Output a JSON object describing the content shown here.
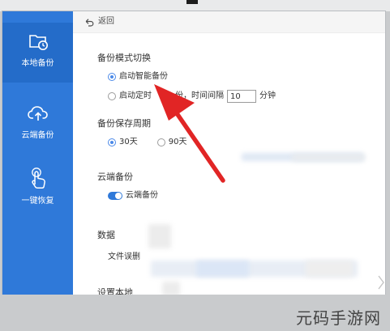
{
  "sidebar": {
    "items": [
      {
        "label": "本地备份",
        "icon": "local-backup-folder-clock-icon",
        "active": true
      },
      {
        "label": "云端备份",
        "icon": "cloud-upload-icon",
        "active": false
      },
      {
        "label": "一键恢复",
        "icon": "hand-touch-icon",
        "active": false
      }
    ],
    "bg_color": "#2f79d9"
  },
  "topbar": {
    "back_label": "返回",
    "back_icon": "back-arrow-icon"
  },
  "backup_mode": {
    "title": "备份模式切换",
    "smart_option": "启动智能备份",
    "timed_option_prefix": "启动定时",
    "timed_option_suffix": "份，时间间隔",
    "interval_value": "10",
    "interval_unit": "分钟"
  },
  "retention": {
    "title": "备份保存周期",
    "option_30": "30天",
    "option_90": "90天"
  },
  "cloud_backup": {
    "title": "云端备份",
    "toggle_label": "云端备份"
  },
  "data_section": {
    "title_partial": "数据",
    "item_partial": "文件误删"
  },
  "settings_section": {
    "title_partial": "设置本地"
  },
  "annotation_arrow_color": "#e12525",
  "watermark_text": "元码手游网"
}
